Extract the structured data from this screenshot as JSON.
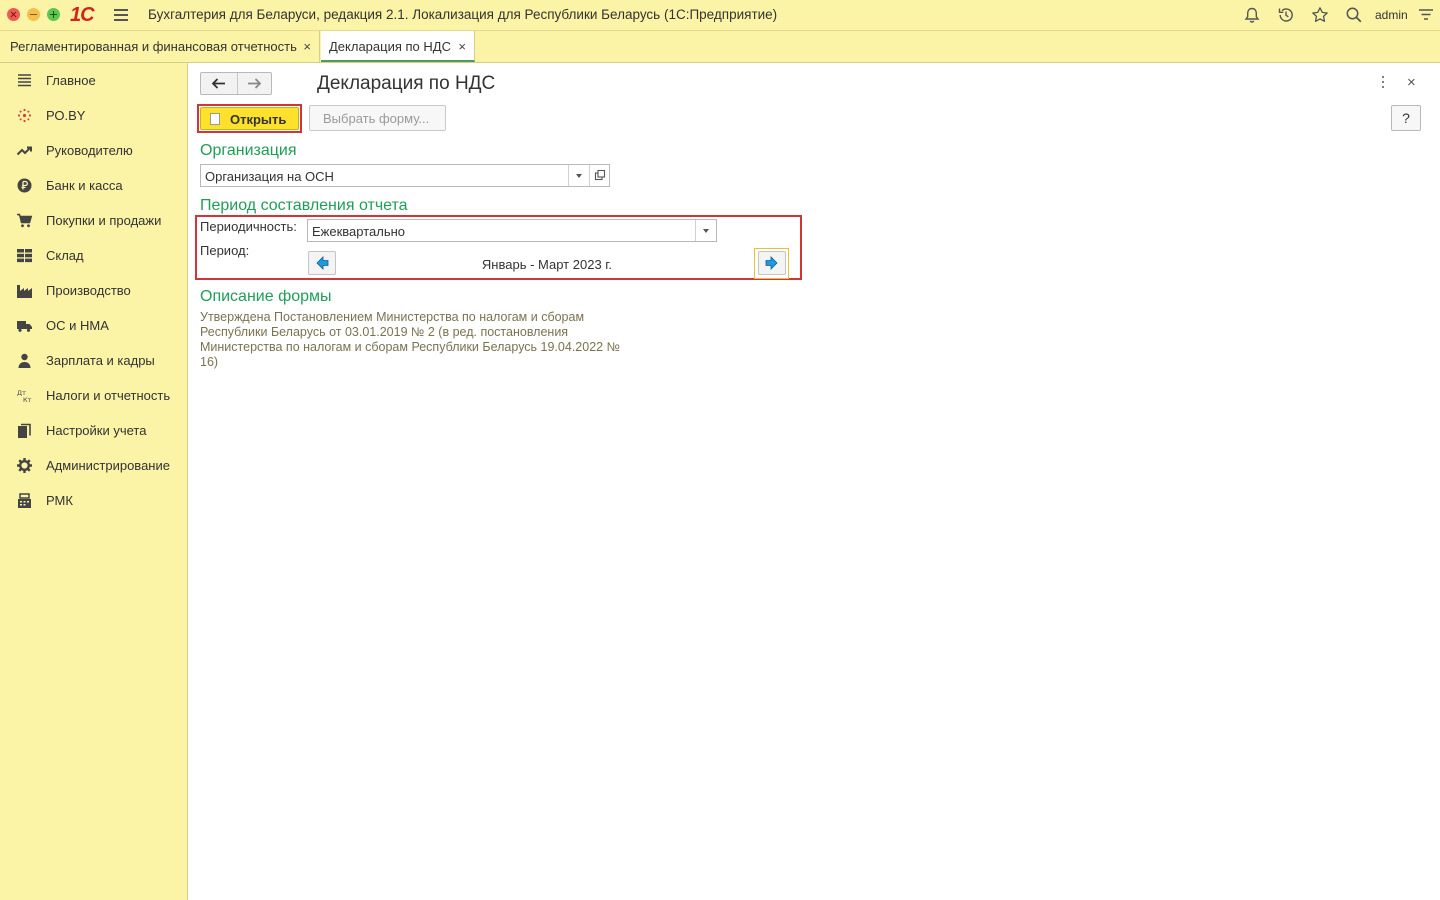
{
  "app": {
    "title": "Бухгалтерия для Беларуси, редакция 2.1. Локализация для Республики Беларусь   (1С:Предприятие)",
    "logo": "1С",
    "user": "admin",
    "icons": [
      "bell-icon",
      "history-icon",
      "star-icon",
      "search-icon",
      "settings-menu-icon"
    ]
  },
  "tabs": [
    {
      "label": "Регламентированная и финансовая отчетность",
      "close": "×"
    },
    {
      "label": "Декларация по НДС",
      "close": "×"
    }
  ],
  "sidebar": {
    "items": [
      {
        "label": "Главное",
        "icon": "main-menu-icon"
      },
      {
        "label": "РО.BY",
        "icon": "ro-by-icon"
      },
      {
        "label": "Руководителю",
        "icon": "trend-icon"
      },
      {
        "label": "Банк и касса",
        "icon": "coin-icon"
      },
      {
        "label": "Покупки и продажи",
        "icon": "cart-icon"
      },
      {
        "label": "Склад",
        "icon": "warehouse-icon"
      },
      {
        "label": "Производство",
        "icon": "factory-icon"
      },
      {
        "label": "ОС и НМА",
        "icon": "truck-icon"
      },
      {
        "label": "Зарплата и кадры",
        "icon": "person-icon"
      },
      {
        "label": "Налоги и отчетность",
        "icon": "dt-kt-icon"
      },
      {
        "label": "Настройки учета",
        "icon": "documents-icon"
      },
      {
        "label": "Администрирование",
        "icon": "gear-icon"
      },
      {
        "label": "РМК",
        "icon": "cash-register-icon"
      }
    ]
  },
  "form": {
    "title": "Декларация по НДС",
    "open_button": "Открыть",
    "choose_form_button": "Выбрать форму...",
    "help_button": "?",
    "close": "×",
    "organization": {
      "section": "Организация",
      "value": "Организация на ОСН"
    },
    "period": {
      "section": "Период составления отчета",
      "periodicity_label": "Периодичность:",
      "periodicity_value": "Ежеквартально",
      "period_label": "Период:",
      "period_value": "Январь - Март 2023 г."
    },
    "description": {
      "section": "Описание формы",
      "text": "Утверждена Постановлением Министерства по налогам и сборам Республики Беларусь от 03.01.2019 № 2 (в ред. постановления Министерства по налогам и сборам Республики Беларусь 19.04.2022 № 16)"
    }
  },
  "colors": {
    "panel": "#fbf3a5",
    "accent_green": "#1f9e57",
    "open_button": "#fde12c",
    "highlight_red": "#d0353a",
    "arrow_blue": "#1e9ae0"
  }
}
